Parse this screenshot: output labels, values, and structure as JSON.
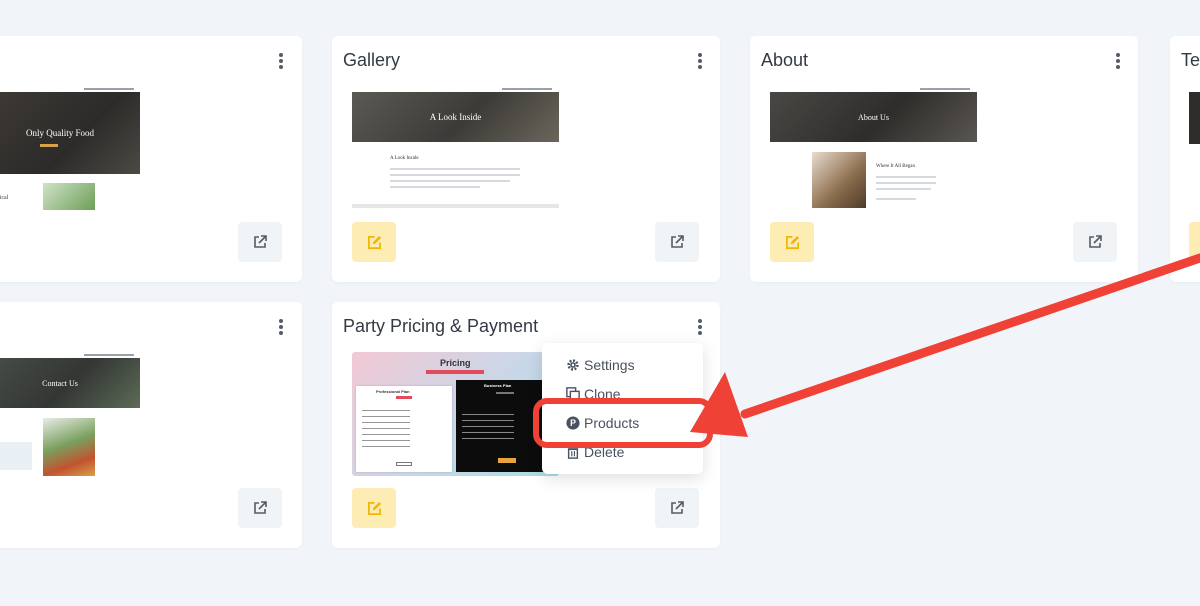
{
  "cards": [
    {
      "title": "",
      "thumb_heading": "Only Quality Food",
      "thumb_text": "lical"
    },
    {
      "title": "Gallery",
      "thumb_heading": "A Look Inside",
      "thumb_sub": "A Look Inside"
    },
    {
      "title": "About",
      "thumb_heading": "About Us",
      "thumb_sub": "Where It All Began"
    },
    {
      "title": "Tea"
    },
    {
      "title": "",
      "thumb_heading": "Contact Us"
    },
    {
      "title": "Party Pricing & Payment",
      "thumb_heading": "Pricing",
      "plan_a": "Professional Plan",
      "plan_b": "Business Plan"
    }
  ],
  "context_menu": {
    "items": [
      {
        "label": "Settings",
        "icon": "gear-icon"
      },
      {
        "label": "Clone",
        "icon": "clone-icon"
      },
      {
        "label": "Products",
        "icon": "products-p-icon"
      },
      {
        "label": "Delete",
        "icon": "trash-icon"
      }
    ]
  },
  "colors": {
    "background": "#f1f5f9",
    "edit_button": "#fdedb5",
    "edit_icon": "#f4b400",
    "annotation": "#ef4136"
  }
}
